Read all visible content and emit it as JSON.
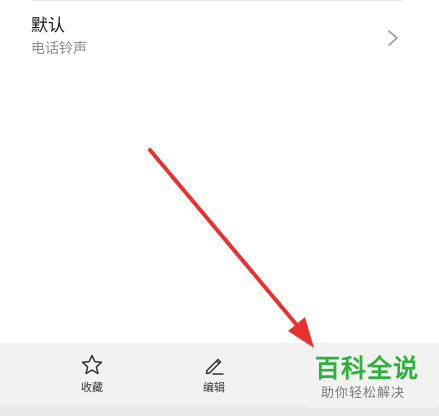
{
  "ringtone": {
    "title": "默认",
    "subtitle": "电话铃声"
  },
  "bottom_bar": {
    "actions": [
      {
        "label": "收藏",
        "icon": "star-icon"
      },
      {
        "label": "编辑",
        "icon": "pencil-icon"
      }
    ]
  },
  "watermark": {
    "title": "百科全说",
    "subtitle": "助你轻松解决"
  },
  "colors": {
    "arrow": "#e8322f",
    "watermark_green": "#2db13c",
    "bar_background": "#f2f2f2"
  }
}
